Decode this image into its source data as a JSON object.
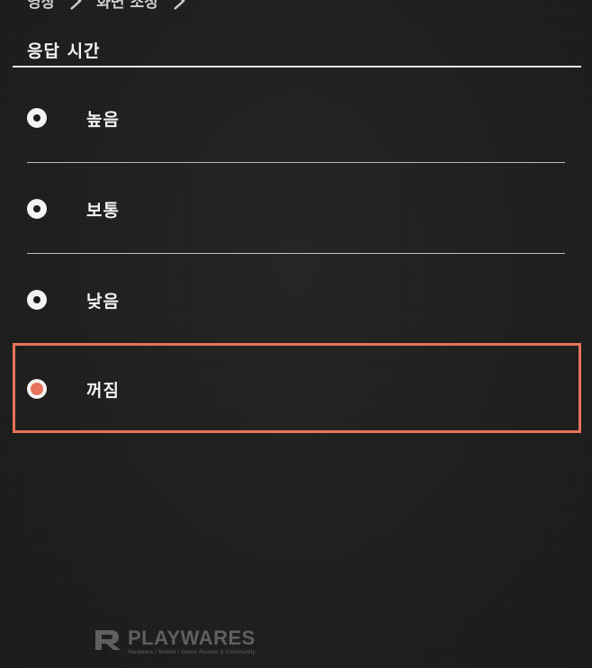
{
  "breadcrumb": {
    "items": [
      "영상",
      "화면 조정"
    ]
  },
  "section": {
    "title": "응답 시간"
  },
  "options": [
    {
      "label": "높음",
      "selected": false
    },
    {
      "label": "보통",
      "selected": false
    },
    {
      "label": "낮음",
      "selected": false
    },
    {
      "label": "꺼짐",
      "selected": true
    }
  ],
  "colors": {
    "background": "#1c1c1b",
    "accent": "#e8735a",
    "text": "#f3f3f3"
  },
  "watermark": {
    "brand": "PLAYWARES",
    "tagline": "Hardware / Mobile / Game Review & Community",
    "icon": "playwares-logo-icon"
  }
}
